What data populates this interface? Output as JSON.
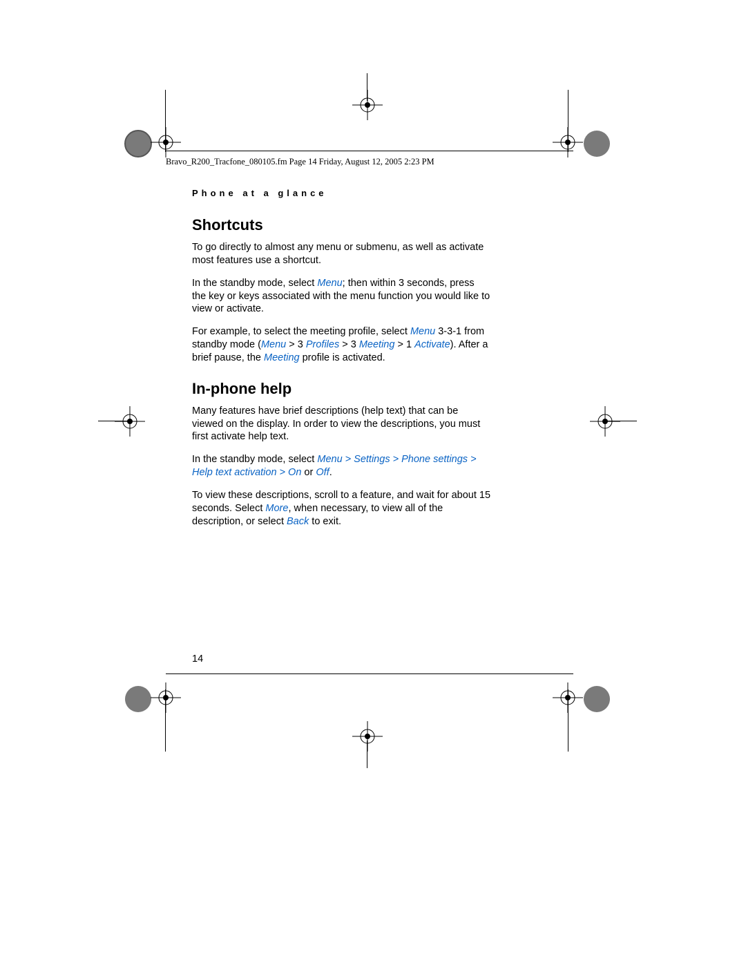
{
  "header": {
    "file_line": "Bravo_R200_Tracfone_080105.fm  Page 14  Friday, August 12, 2005  2:23 PM",
    "section_label": "Phone at a glance"
  },
  "sections": {
    "shortcuts": {
      "title": "Shortcuts",
      "p1a": "To go directly to almost any menu or submenu, as well as activate most features use a shortcut.",
      "p2a": "In the standby mode, select ",
      "p2_menu": "Menu",
      "p2b": "; then within 3 seconds, press the key or keys associated with the menu function you would like to view or activate.",
      "p3a": "For example, to select the meeting profile, select ",
      "p3_menu": "Menu",
      "p3b": " 3-3-1 from standby mode (",
      "p3_path_menu": "Menu",
      "p3_sep1": " > ",
      "p3_n1": "3 ",
      "p3_profiles": "Profiles",
      "p3_sep2": " > ",
      "p3_n2": "3 ",
      "p3_meeting": "Meeting",
      "p3_sep3": " > ",
      "p3_n3": "1 ",
      "p3_activate": "Activate",
      "p3c": "). After a brief pause, the ",
      "p3_meeting2": "Meeting",
      "p3d": " profile is activated."
    },
    "help": {
      "title": "In-phone help",
      "p1": "Many features have brief descriptions (help text) that can be viewed on the display. In order to view the descriptions, you must first activate help text.",
      "p2a": "In the standby mode, select ",
      "p2_menu": "Menu",
      "p2_sep1": " > ",
      "p2_settings": "Settings",
      "p2_sep2": " > ",
      "p2_phone": "Phone settings",
      "p2_sep3": " > ",
      "p2_helptext": "Help text activation",
      "p2_sep4": " > ",
      "p2_on": "On",
      "p2_or": " or ",
      "p2_off": "Off",
      "p2_end": ".",
      "p3a": "To view these descriptions, scroll to a feature, and wait for about 15 seconds. Select ",
      "p3_more": "More",
      "p3b": ", when necessary, to view all of the description, or select ",
      "p3_back": "Back",
      "p3c": " to exit."
    }
  },
  "page_number": "14"
}
